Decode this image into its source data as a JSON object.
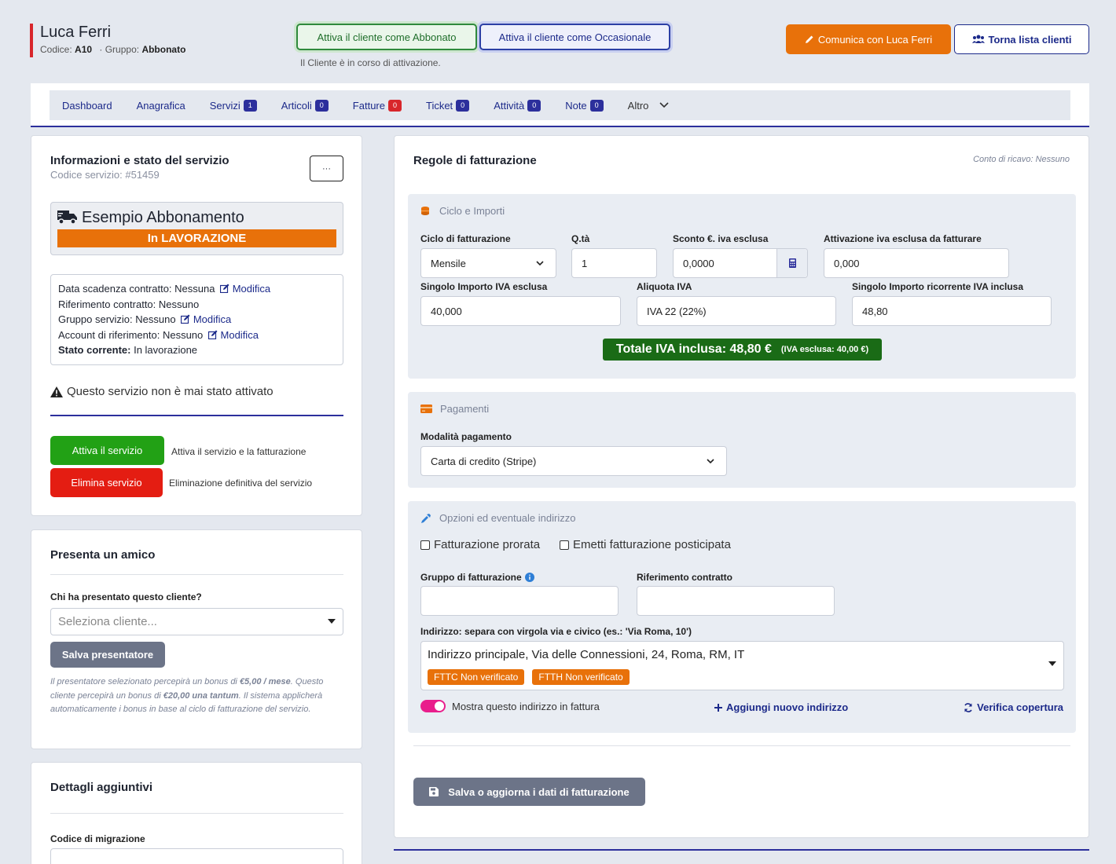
{
  "header": {
    "client_name": "Luca Ferri",
    "code_label": "Codice:",
    "code_value": "A10",
    "group_label": "· Gruppo:",
    "group_value": "Abbonato",
    "activate_subscriber": "Attiva il cliente come Abbonato",
    "activate_occasional": "Attiva il cliente come Occasionale",
    "activation_note": "Il Cliente è in corso di attivazione.",
    "communicate_button": "Comunica con Luca Ferri",
    "back_button": "Torna lista clienti"
  },
  "nav": {
    "items": [
      {
        "label": "Dashboard"
      },
      {
        "label": "Anagrafica"
      },
      {
        "label": "Servizi",
        "badge": "1"
      },
      {
        "label": "Articoli",
        "badge": "0"
      },
      {
        "label": "Fatture",
        "badge": "0"
      },
      {
        "label": "Ticket",
        "badge": "0"
      },
      {
        "label": "Attività",
        "badge": "0"
      },
      {
        "label": "Note",
        "badge": "0"
      },
      {
        "label": "Altro"
      }
    ]
  },
  "service_info": {
    "title": "Informazioni e stato del servizio",
    "code": "Codice servizio: #51459",
    "menu_button": "···",
    "service_name": "Esempio Abbonamento",
    "status_banner": "In LAVORAZIONE",
    "contract_expiry": "Data scadenza contratto: Nessuna",
    "contract_ref": "Riferimento contratto: Nessuno",
    "service_group": "Gruppo servizio: Nessuno",
    "ref_account": "Account di riferimento: Nessuno",
    "current_state_label": "Stato corrente:",
    "current_state_value": "In lavorazione",
    "modify_label": "Modifica",
    "warning": "Questo servizio non è mai stato attivato",
    "activate_button": "Attiva il servizio",
    "activate_desc": "Attiva il servizio e la fatturazione",
    "delete_button": "Elimina servizio",
    "delete_desc": "Eliminazione definitiva del servizio"
  },
  "referral": {
    "title": "Presenta un amico",
    "question": "Chi ha presentato questo cliente?",
    "placeholder": "Seleziona cliente...",
    "save_button": "Salva presentatore",
    "note_1": "Il presentatore selezionato percepirà un bonus di",
    "bonus_presenter": "€5,00 / mese",
    "note_2": "Questo cliente percepirà un bonus di",
    "bonus_client": "€20,00 una tantum",
    "note_3": "Il sistema applicherà automaticamente i bonus in base al ciclo di fatturazione del servizio."
  },
  "extra_details": {
    "title": "Dettagli aggiuntivi",
    "migration_code_label": "Codice di migrazione"
  },
  "billing": {
    "title": "Regole di fatturazione",
    "revenue_account": "Conto di ricavo: Nessuno",
    "cycle_section": {
      "title": "Ciclo e Importi",
      "cycle_label": "Ciclo di fatturazione",
      "cycle_value": "Mensile",
      "qty_label": "Q.tà",
      "qty_value": "1",
      "discount_label": "Sconto €. iva esclusa",
      "discount_value": "0,0000",
      "activation_label_1": "Attivazione iva esclusa",
      "activation_label_2": "da fatturare",
      "activation_value": "0,000",
      "single_amount_label": "Singolo Importo IVA esclusa",
      "single_amount_value": "40,000",
      "vat_label": "Aliquota IVA",
      "vat_value": "IVA 22 (22%)",
      "recurring_label": "Singolo Importo ricorrente IVA inclusa",
      "recurring_value": "48,80",
      "total_main": "Totale IVA inclusa: 48,80 €",
      "total_sub": "(IVA esclusa: 40,00 €)"
    },
    "payments_section": {
      "title": "Pagamenti",
      "method_label": "Modalità pagamento",
      "method_value": "Carta di credito (Stripe)"
    },
    "options_section": {
      "title": "Opzioni ed eventuale indirizzo",
      "prorata_label": "Fatturazione prorata",
      "deferred_label": "Emetti fatturazione posticipata",
      "billing_group_label": "Gruppo di fatturazione",
      "contract_ref_label": "Riferimento contratto",
      "address_label": "Indirizzo: separa con virgola via e civico (es.: 'Via Roma, 10')",
      "address_value": "Indirizzo principale, Via delle Connessioni, 24, Roma, RM, IT",
      "tag_fttc": "FTTC Non verificato",
      "tag_ftth": "FTTH Non verificato",
      "show_address_label": "Mostra questo indirizzo in fattura",
      "add_address": "Aggiungi nuovo indirizzo",
      "check_coverage": "Verifica copertura"
    },
    "save_button": "Salva o aggiorna i dati di fatturazione"
  },
  "colors": {
    "accent_blue": "#1c2a8a",
    "orange": "#e8710a",
    "green": "#22a115",
    "red": "#e41d12",
    "total_green": "#1a6b16",
    "toggle_pink": "#e91e8c"
  }
}
